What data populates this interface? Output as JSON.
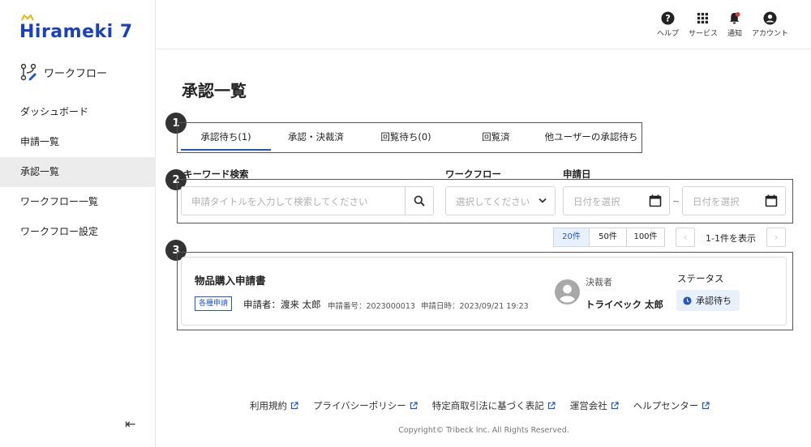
{
  "brand": {
    "logo_text": "Hirameki 7"
  },
  "module": {
    "label": "ワークフロー"
  },
  "sidebar": {
    "items": [
      {
        "label": "ダッシュボード"
      },
      {
        "label": "申請一覧"
      },
      {
        "label": "承認一覧"
      },
      {
        "label": "ワークフロー一覧"
      },
      {
        "label": "ワークフロー設定"
      }
    ],
    "collapse_icon": "⇤"
  },
  "header": {
    "actions": [
      {
        "label": "ヘルプ",
        "icon": "help-icon"
      },
      {
        "label": "サービス",
        "icon": "grid-icon"
      },
      {
        "label": "通知",
        "icon": "bell-icon"
      },
      {
        "label": "アカウント",
        "icon": "account-icon"
      }
    ]
  },
  "page": {
    "title": "承認一覧"
  },
  "steps": [
    "1",
    "2",
    "3"
  ],
  "tabs": [
    {
      "label": "承認待ち(1)"
    },
    {
      "label": "承認・決裁済"
    },
    {
      "label": "回覧待ち(0)"
    },
    {
      "label": "回覧済"
    },
    {
      "label": "他ユーザーの承認待ち"
    }
  ],
  "filters": {
    "keyword_label": "キーワード検索",
    "keyword_placeholder": "申請タイトルを入力して検索してください",
    "workflow_label": "ワークフロー",
    "workflow_placeholder": "選択してください",
    "date_label": "申請日",
    "date_from_placeholder": "日付を選択",
    "date_to_placeholder": "日付を選択",
    "date_separator": "~"
  },
  "pagination": {
    "sizes": [
      "20件",
      "50件",
      "100件"
    ],
    "count_text": "1-1件を表示",
    "prev": "‹",
    "next": "›"
  },
  "requests": [
    {
      "title": "物品購入申請書",
      "tag": "各種申請",
      "applicant": "申請者：渡来 太郎",
      "number": "申請番号：2023000013",
      "date": "申請日時：2023/09/21 19:23",
      "approver_label": "決裁者",
      "approver_name": "トライベック 太郎",
      "status_label": "ステータス",
      "status": "承認待ち"
    }
  ],
  "footer": {
    "links": [
      {
        "label": "利用規約"
      },
      {
        "label": "プライバシーポリシー"
      },
      {
        "label": "特定商取引法に基づく表記"
      },
      {
        "label": "運営会社"
      },
      {
        "label": "ヘルプセンター"
      }
    ],
    "copyright": "Copyright© Tribeck Inc. All Rights Reserved."
  },
  "colors": {
    "accent": "#2456c7",
    "logo": "#1a3fbf",
    "notification": "#e53935"
  }
}
